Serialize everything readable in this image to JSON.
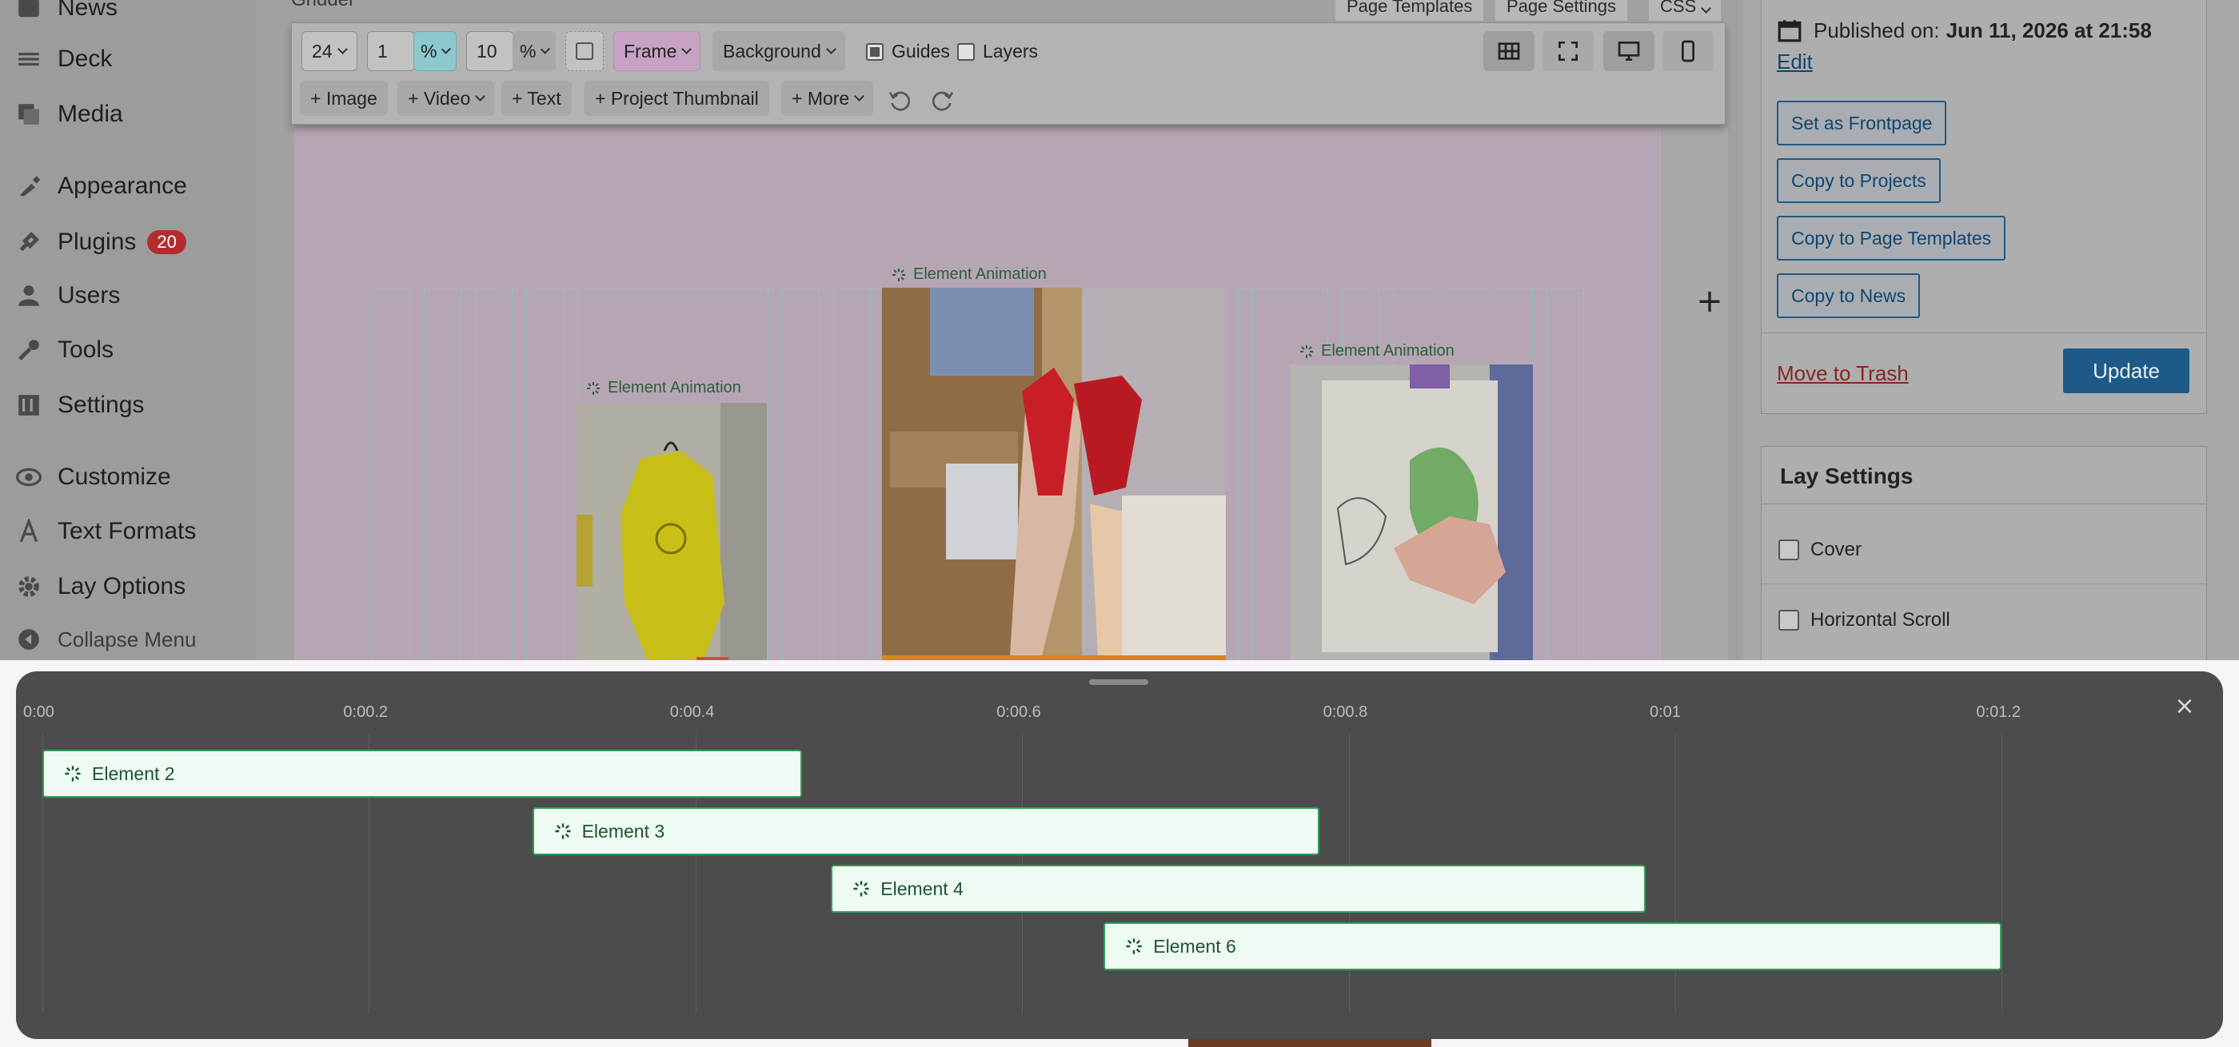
{
  "sidebar": {
    "items": [
      {
        "label": "News",
        "icon": "news-icon"
      },
      {
        "label": "Deck",
        "icon": "deck-icon"
      },
      {
        "label": "Media",
        "icon": "media-icon"
      },
      {
        "label": "Appearance",
        "icon": "appearance-icon"
      },
      {
        "label": "Plugins",
        "icon": "plugins-icon",
        "badge": "20"
      },
      {
        "label": "Users",
        "icon": "users-icon"
      },
      {
        "label": "Tools",
        "icon": "tools-icon"
      },
      {
        "label": "Settings",
        "icon": "settings-icon"
      },
      {
        "label": "Customize",
        "icon": "customize-icon"
      },
      {
        "label": "Text Formats",
        "icon": "text-formats-icon"
      },
      {
        "label": "Lay Options",
        "icon": "lay-options-icon"
      },
      {
        "label": "Collapse Menu",
        "icon": "collapse-icon"
      }
    ]
  },
  "editor": {
    "title": "Gridder",
    "tabs": [
      "Page Templates",
      "Page Settings",
      "CSS"
    ]
  },
  "toolbar": {
    "columns": "24",
    "gutter_value": "1",
    "gutter_unit": "%",
    "frame_value": "10",
    "frame_unit": "%",
    "frame_label": "Frame",
    "background_label": "Background",
    "guides_label": "Guides",
    "guides_checked": true,
    "layers_label": "Layers",
    "layers_checked": false,
    "add_image": "+ Image",
    "add_video": "+ Video",
    "add_text": "+ Text",
    "add_thumbnail": "+ Project Thumbnail",
    "add_more": "+ More"
  },
  "canvas": {
    "animation_label": "Element Animation",
    "plus": "+"
  },
  "publish": {
    "published_prefix": "Published on:",
    "published_date": "Jun 11, 2026 at 21:58",
    "edit_link": "Edit",
    "set_frontpage": "Set as Frontpage",
    "copy_projects": "Copy to Projects",
    "copy_templates": "Copy to Page Templates",
    "copy_news": "Copy to News",
    "trash": "Move to Trash",
    "update": "Update"
  },
  "lay_settings": {
    "title": "Lay Settings",
    "cover": "Cover",
    "horizontal_scroll": "Horizontal Scroll"
  },
  "timeline": {
    "ticks": [
      "0:00",
      "0:00.2",
      "0:00.4",
      "0:00.6",
      "0:00.8",
      "0:01",
      "0:01.2"
    ],
    "close": "×",
    "elements": [
      {
        "label": "Element 2",
        "start": 0.0,
        "end": 0.465
      },
      {
        "label": "Element 3",
        "start": 0.3,
        "end": 0.782
      },
      {
        "label": "Element 4",
        "start": 0.483,
        "end": 0.982
      },
      {
        "label": "Element 6",
        "start": 0.65,
        "end": 1.2
      }
    ]
  },
  "colors": {
    "accent_green": "#2f9e5a",
    "wp_blue": "#2271b1",
    "badge_red": "#b32d2e",
    "timeline_bg": "#4c4c4c"
  }
}
